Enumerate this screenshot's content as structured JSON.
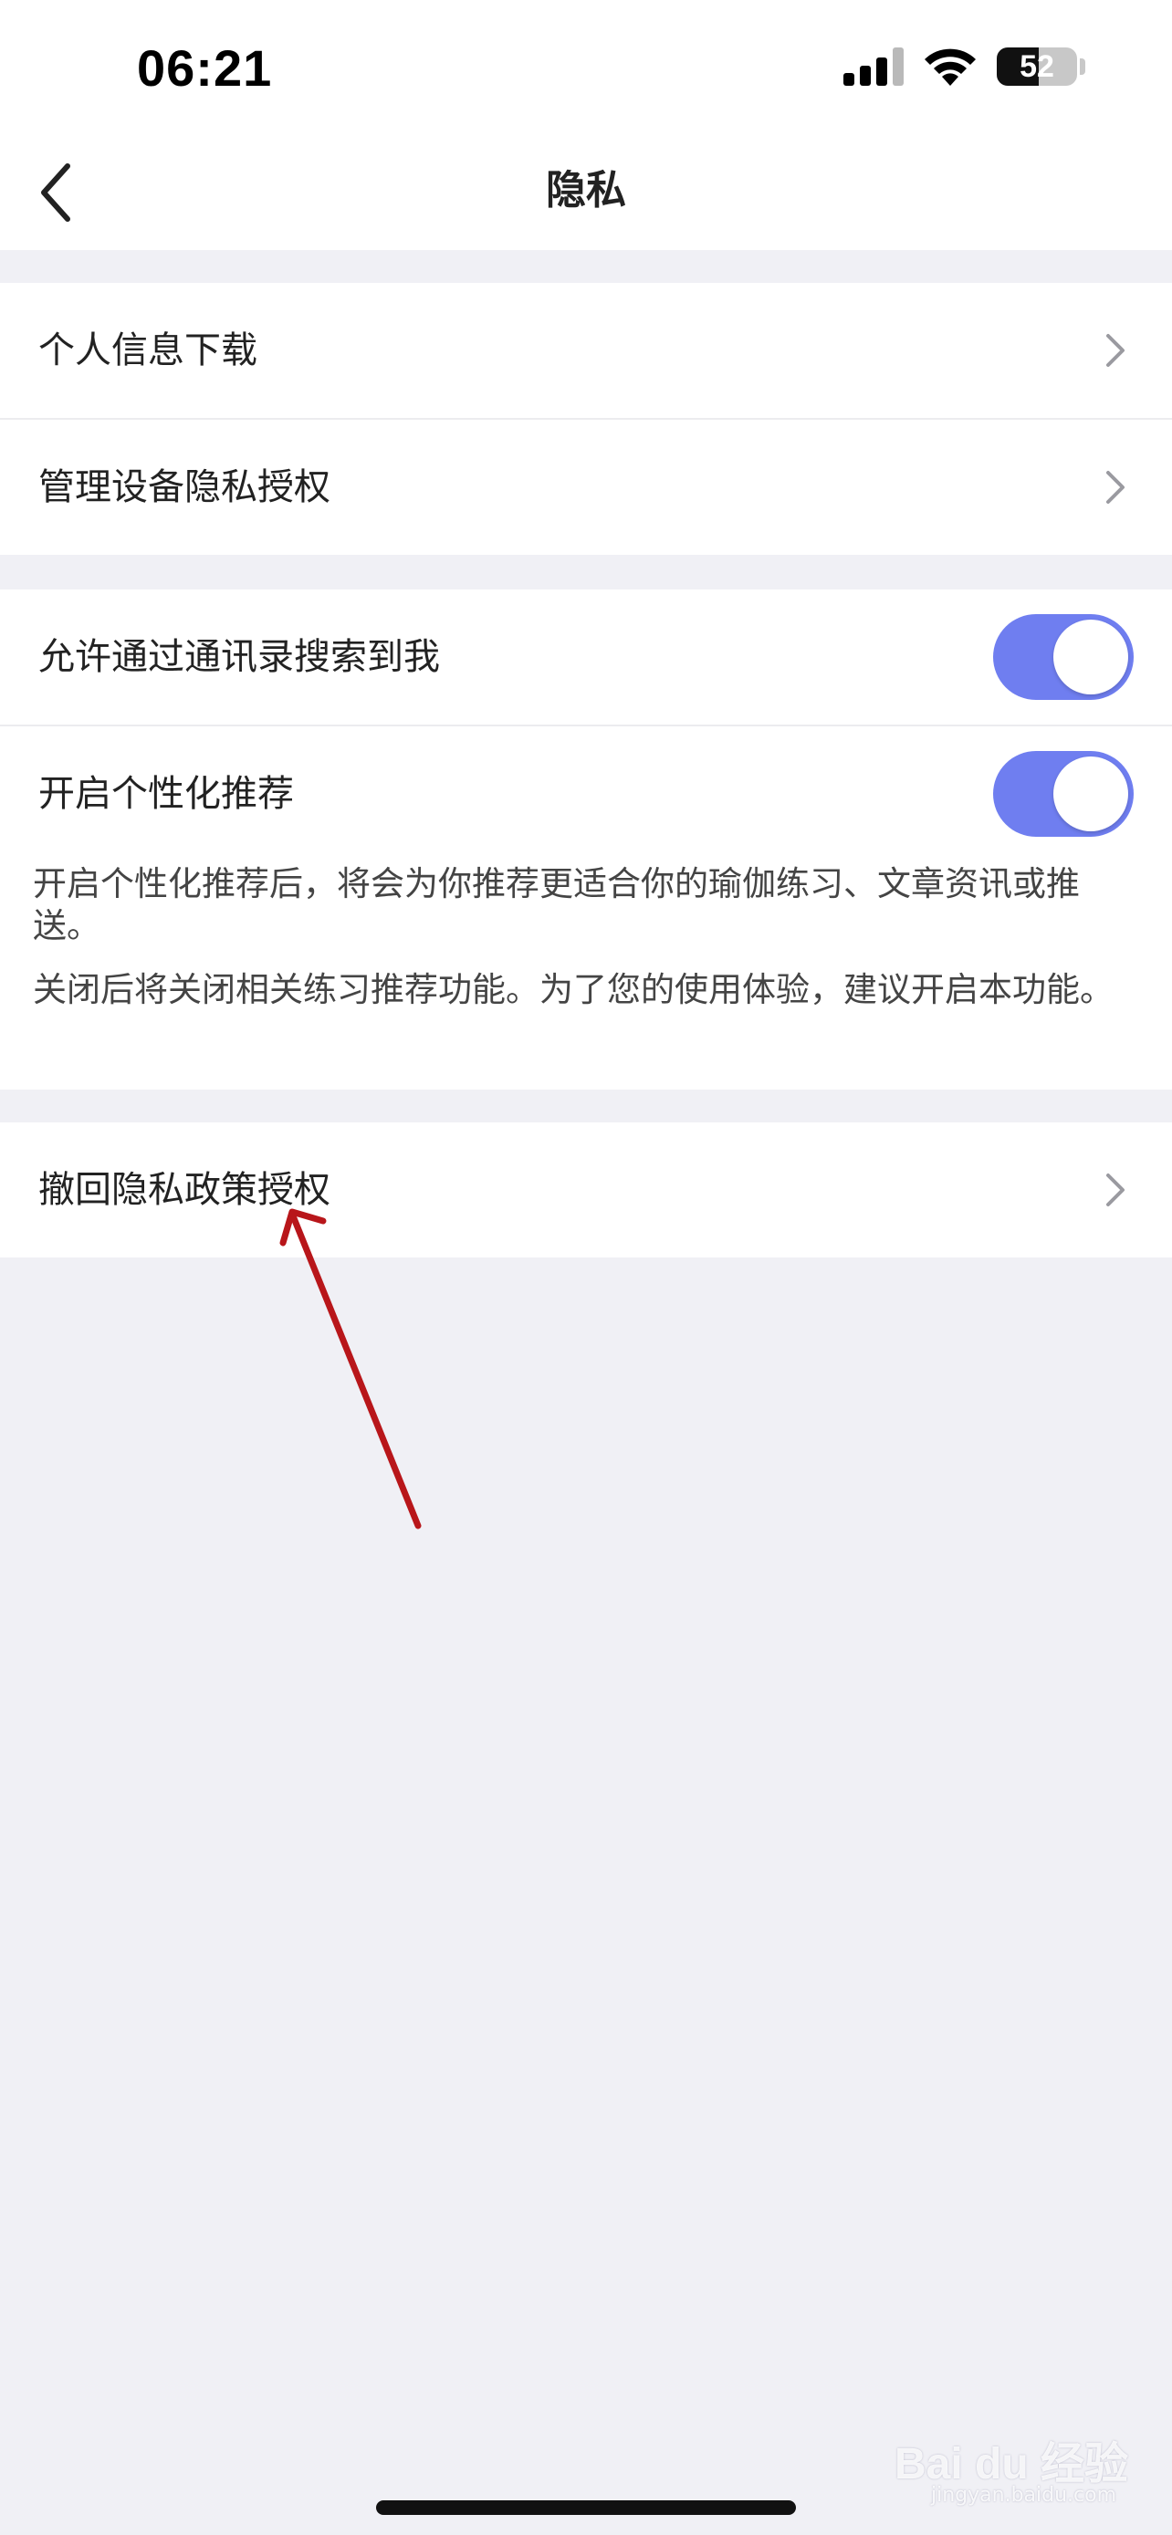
{
  "status_bar": {
    "time": "06:21",
    "battery_level": "52",
    "battery_fraction": 0.52,
    "icons": [
      "signal-icon",
      "wifi-icon",
      "battery-icon"
    ]
  },
  "nav": {
    "title": "隐私",
    "back_icon": "back-chevron-icon"
  },
  "group_1": {
    "items": [
      {
        "label": "个人信息下载",
        "icon": "chevron-right-icon"
      },
      {
        "label": "管理设备隐私授权",
        "icon": "chevron-right-icon"
      }
    ]
  },
  "group_2": {
    "items": [
      {
        "label": "允许通过通讯录搜索到我",
        "toggle_on": true
      },
      {
        "label": "开启个性化推荐",
        "toggle_on": true
      }
    ],
    "desc_1": "开启个性化推荐后，将会为你推荐更适合你的瑜伽练习、文章资讯或推送。",
    "desc_2": "关闭后将关闭相关练习推荐功能。为了您的使用体验，建议开启本功能。"
  },
  "group_3": {
    "items": [
      {
        "label": "撤回隐私政策授权",
        "icon": "chevron-right-icon"
      }
    ]
  },
  "watermark": {
    "brand": "Bai du 经验",
    "sub": "jingyan.baidu.com"
  },
  "colors": {
    "toggle_on": "#6f7ef0",
    "background": "#f0f0f5",
    "annotation": "#b8161a"
  }
}
